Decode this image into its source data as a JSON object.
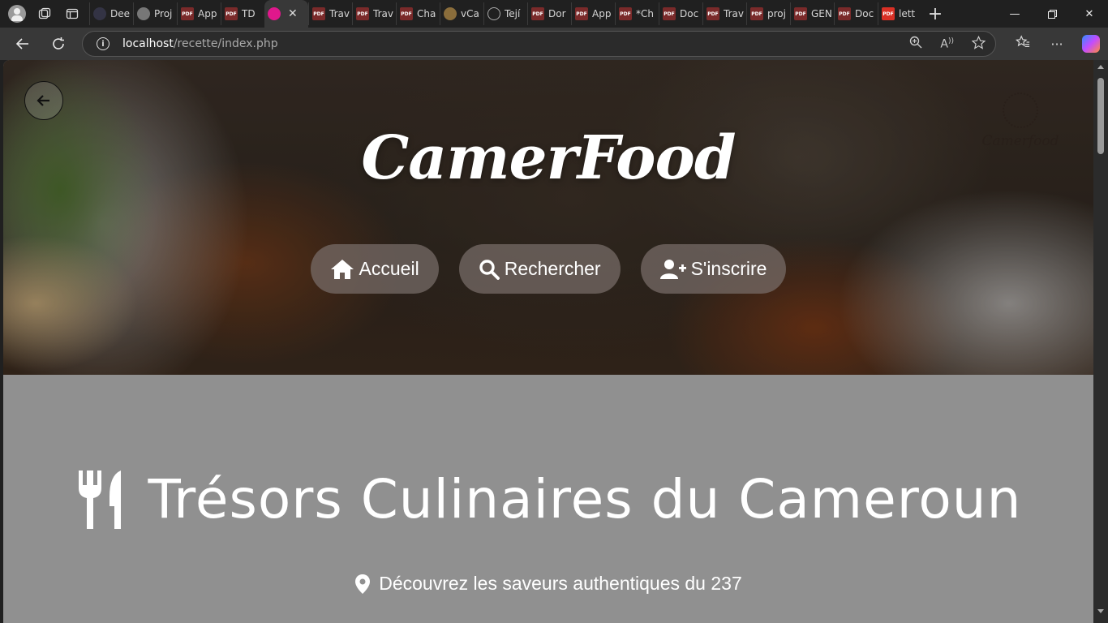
{
  "browser": {
    "tabs": [
      {
        "label": "Dee",
        "icon": "deepl-icon"
      },
      {
        "label": "Proj",
        "icon": "gear-icon"
      },
      {
        "label": "App",
        "icon": "pdf-icon"
      },
      {
        "label": "TD",
        "icon": "pdf-icon"
      },
      {
        "label": "",
        "icon": "app-icon",
        "active": true
      },
      {
        "label": "Trav",
        "icon": "pdf-icon"
      },
      {
        "label": "Trav",
        "icon": "pdf-icon"
      },
      {
        "label": "Cha",
        "icon": "pdf-icon"
      },
      {
        "label": "vCa",
        "icon": "app-icon"
      },
      {
        "label": "Tejí",
        "icon": "globe-icon"
      },
      {
        "label": "Dor",
        "icon": "pdf-icon"
      },
      {
        "label": "App",
        "icon": "pdf-icon"
      },
      {
        "label": "*Ch",
        "icon": "pdf-icon"
      },
      {
        "label": "Doc",
        "icon": "pdf-icon"
      },
      {
        "label": "Trav",
        "icon": "pdf-icon"
      },
      {
        "label": "proj",
        "icon": "pdf-icon"
      },
      {
        "label": "GEN",
        "icon": "pdf-icon"
      },
      {
        "label": "Doc",
        "icon": "pdf-icon"
      },
      {
        "label": "lett",
        "icon": "pdf-icon"
      }
    ],
    "pdf_badge": "PDF",
    "url_host": "localhost",
    "url_path": "/recette/index.php"
  },
  "hero": {
    "brand": "CamerFood",
    "logo_text": "Camerfood",
    "nav": {
      "home": "Accueil",
      "search": "Rechercher",
      "signup": "S'inscrire"
    }
  },
  "section": {
    "heading": "Trésors Culinaires du Cameroun",
    "subtitle": "Découvrez les saveurs authentiques du 237"
  },
  "colors": {
    "page_bg": "#909090",
    "chrome_dark": "#202020",
    "toolbar": "#383838",
    "nav_pill": "#7a6e69",
    "text_light": "#ffffff"
  }
}
